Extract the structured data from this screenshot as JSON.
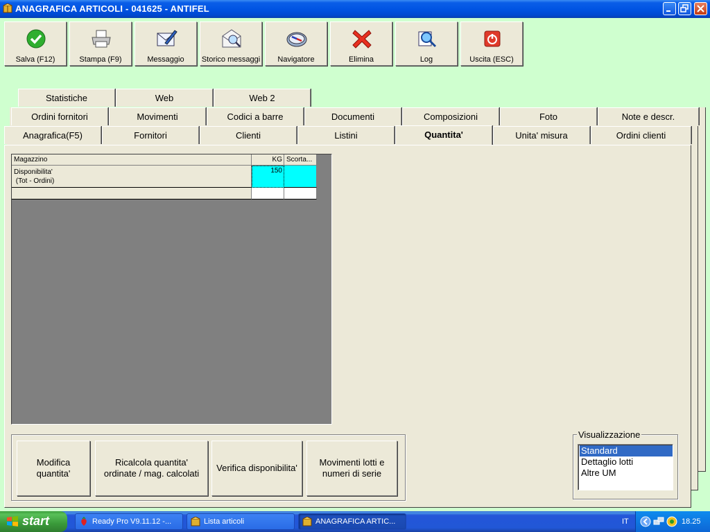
{
  "window": {
    "title": "ANAGRAFICA ARTICOLI - 041625 - ANTIFEL"
  },
  "toolbar": [
    {
      "label": "Salva (F12)",
      "icon": "check-icon"
    },
    {
      "label": "Stampa (F9)",
      "icon": "printer-icon"
    },
    {
      "label": "Messaggio",
      "icon": "message-pen-icon"
    },
    {
      "label": "Storico messaggi",
      "icon": "message-search-icon"
    },
    {
      "label": "Navigatore",
      "icon": "compass-icon"
    },
    {
      "label": "Elimina",
      "icon": "delete-x-icon"
    },
    {
      "label": "Log",
      "icon": "log-search-icon"
    },
    {
      "label": "Uscita (ESC)",
      "icon": "power-icon"
    }
  ],
  "tabs": {
    "row3": [
      "Statistiche",
      "Web",
      "Web 2"
    ],
    "row2": [
      "Ordini fornitori",
      "Movimenti",
      "Codici a barre",
      "Documenti",
      "Composizioni",
      "Foto",
      "Note e descr."
    ],
    "row1": [
      "Anagrafica(F5)",
      "Fornitori",
      "Clienti",
      "Listini",
      "Quantita'",
      "Unita' misura",
      "Ordini clienti"
    ],
    "active": "Quantita'"
  },
  "grid": {
    "headers": [
      "Magazzino",
      "KG",
      "Scorta..."
    ],
    "rows": [
      {
        "label_line1": "Disponibilita'",
        "label_line2": " (Tot - Ordini)",
        "kg": "150",
        "scorta": ""
      }
    ],
    "highlight_color": "#00ffff"
  },
  "buttons": {
    "modifica": "Modifica\nquantita'",
    "ricalcola": "Ricalcola quantita'\nordinate / mag. calcolati",
    "verifica": "Verifica disponibilita'",
    "movimenti": "Movimenti lotti e\nnumeri di serie"
  },
  "visualizzazione": {
    "label": "Visualizzazione",
    "options": [
      "Standard",
      "Dettaglio lotti",
      "Altre UM"
    ],
    "selected": "Standard"
  },
  "taskbar": {
    "start": "start",
    "tasks": [
      "Ready Pro V9.11.12 -...",
      "Lista articoli",
      "ANAGRAFICA ARTIC..."
    ],
    "lang": "IT",
    "time": "18.25"
  }
}
